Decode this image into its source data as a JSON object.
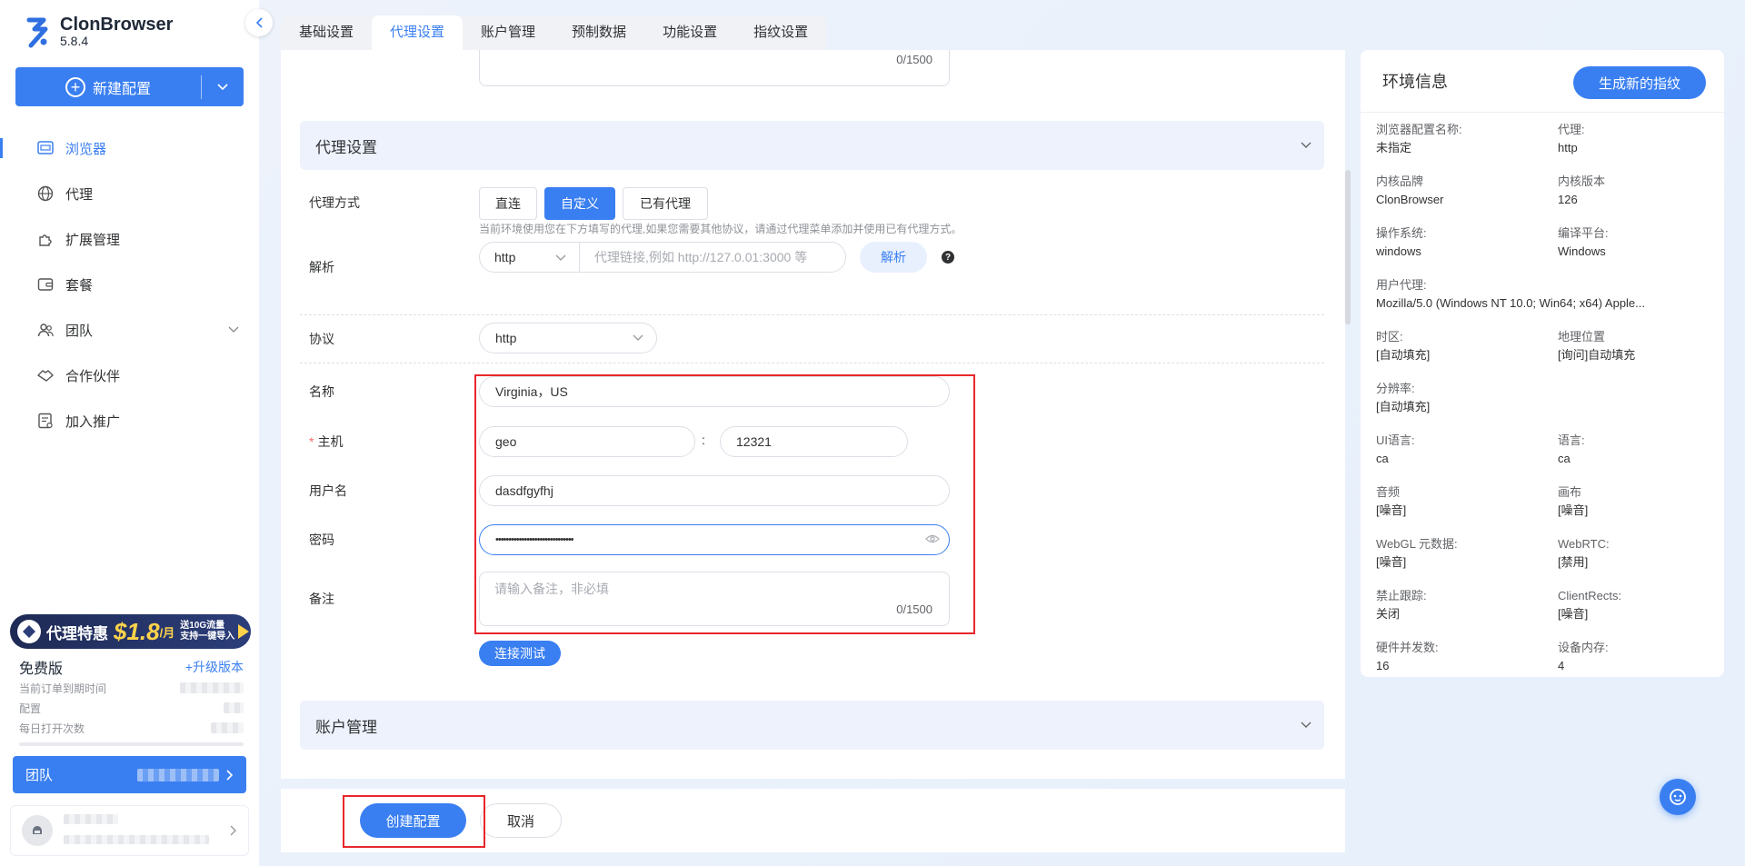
{
  "app": {
    "name": "ClonBrowser",
    "version": "5.8.4"
  },
  "sidebar": {
    "new_config_label": "新建配置",
    "items": [
      {
        "label": "浏览器",
        "icon": "browser-icon",
        "active": true
      },
      {
        "label": "代理",
        "icon": "globe-icon"
      },
      {
        "label": "扩展管理",
        "icon": "puzzle-icon"
      },
      {
        "label": "套餐",
        "icon": "wallet-icon"
      },
      {
        "label": "团队",
        "icon": "team-icon"
      },
      {
        "label": "合作伙伴",
        "icon": "handshake-icon"
      },
      {
        "label": "加入推广",
        "icon": "promote-icon"
      }
    ],
    "promo": {
      "title": "代理特惠",
      "price": "$1.8",
      "unit": "/月",
      "line1": "送10G流量",
      "line2": "支持一键导入"
    },
    "plan": {
      "name": "免费版",
      "upgrade": "+升级版本",
      "expire_label": "当前订单到期时间",
      "config_label": "配置",
      "daily_label": "每日打开次数"
    },
    "team_label": "团队"
  },
  "tabs": [
    "基础设置",
    "代理设置",
    "账户管理",
    "预制数据",
    "功能设置",
    "指纹设置"
  ],
  "active_tab": 1,
  "form": {
    "top_counter": "0/1500",
    "proxy_section_title": "代理设置",
    "proxy_mode_label": "代理方式",
    "proxy_modes": [
      "直连",
      "自定义",
      "已有代理"
    ],
    "active_mode": 1,
    "hint": "当前环境使用您在下方填写的代理,如果您需要其他协议，请通过代理菜单添加并使用已有代理方式。",
    "parse_label": "解析",
    "parse_protocol": "http",
    "parse_placeholder": "代理链接,例如 http://127.0.01:3000 等",
    "parse_button": "解析",
    "protocol_label": "协议",
    "protocol_value": "http",
    "name_label": "名称",
    "name_value": "Virginia，US",
    "host_label": "主机",
    "host_value": "geo",
    "port_separator": ":",
    "port_value": "12321",
    "username_label": "用户名",
    "username_value": "dasdfgyfhj",
    "password_label": "密码",
    "password_value": "••••••••••••••••••••••••••••••",
    "note_label": "备注",
    "note_placeholder": "请输入备注，非必填",
    "note_counter": "0/1500",
    "test_button": "连接测试",
    "account_section_title": "账户管理"
  },
  "footer": {
    "create": "创建配置",
    "cancel": "取消"
  },
  "env": {
    "title": "环境信息",
    "generate_button": "生成新的指纹",
    "fields": [
      {
        "k": "浏览器配置名称:",
        "v": "未指定"
      },
      {
        "k": "代理:",
        "v": "http"
      },
      {
        "k": "内核品牌",
        "v": "ClonBrowser"
      },
      {
        "k": "内核版本",
        "v": "126"
      },
      {
        "k": "操作系统:",
        "v": "windows"
      },
      {
        "k": "编译平台:",
        "v": "Windows"
      },
      {
        "k": "用户代理:",
        "v": "Mozilla/5.0 (Windows NT 10.0; Win64; x64) Apple...",
        "wide": true
      },
      {
        "k": "时区:",
        "v": "[自动填充]"
      },
      {
        "k": "地理位置",
        "v": "[询问]自动填充"
      },
      {
        "k": "分辨率:",
        "v": "[自动填充]",
        "wide": true
      },
      {
        "k": "UI语言:",
        "v": "ca"
      },
      {
        "k": "语言:",
        "v": "ca"
      },
      {
        "k": "音频",
        "v": "[噪音]"
      },
      {
        "k": "画布",
        "v": "[噪音]"
      },
      {
        "k": "WebGL 元数据:",
        "v": "[噪音]"
      },
      {
        "k": "WebRTC:",
        "v": "[禁用]"
      },
      {
        "k": "禁止跟踪:",
        "v": "关闭"
      },
      {
        "k": "ClientRects:",
        "v": "[噪音]"
      },
      {
        "k": "硬件并发数:",
        "v": "16"
      },
      {
        "k": "设备内存:",
        "v": "4"
      }
    ]
  },
  "colors": {
    "primary": "#3a7ff1",
    "highlight": "#e8262a"
  }
}
